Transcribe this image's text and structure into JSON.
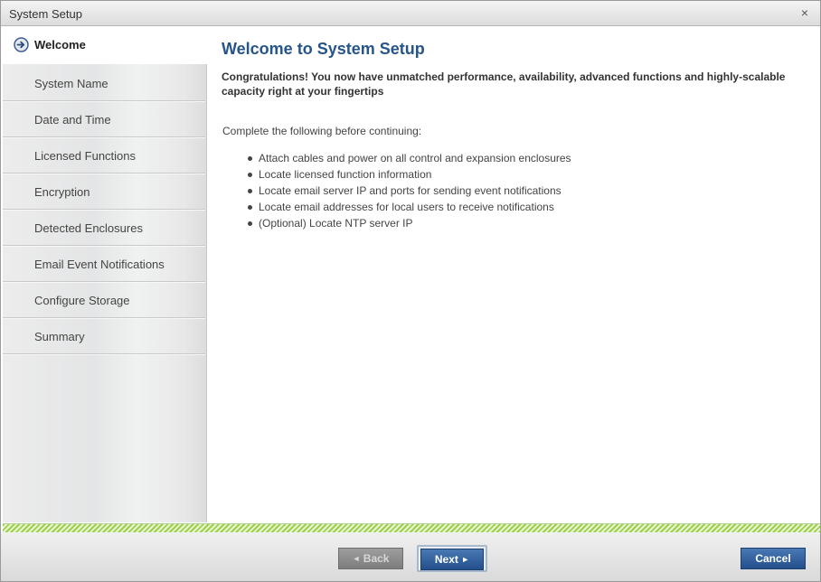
{
  "window": {
    "title": "System Setup",
    "close_glyph": "×"
  },
  "sidebar": {
    "current": {
      "label": "Welcome",
      "icon": "arrow-circle-right-icon"
    },
    "items": [
      {
        "label": "System Name"
      },
      {
        "label": "Date and Time"
      },
      {
        "label": "Licensed Functions"
      },
      {
        "label": "Encryption"
      },
      {
        "label": "Detected Enclosures"
      },
      {
        "label": "Email Event Notifications"
      },
      {
        "label": "Configure Storage"
      },
      {
        "label": "Summary"
      }
    ]
  },
  "main": {
    "heading": "Welcome to System Setup",
    "intro": "Congratulations! You now have unmatched performance, availability, advanced functions and highly-scalable capacity right at your fingertips",
    "lead": "Complete the following before continuing:",
    "checklist": [
      "Attach cables and power on all control and expansion enclosures",
      "Locate licensed function information",
      "Locate email server IP and ports for sending event notifications",
      "Locate email addresses for local users to receive notifications",
      "(Optional) Locate NTP server IP"
    ]
  },
  "footer": {
    "back_label": "Back",
    "back_glyph": "◄",
    "next_label": "Next",
    "next_glyph": "►",
    "cancel_label": "Cancel"
  },
  "colors": {
    "heading": "#25558a",
    "primary_button": "#234f8c",
    "progress_stripe": "#9ccf4a"
  }
}
